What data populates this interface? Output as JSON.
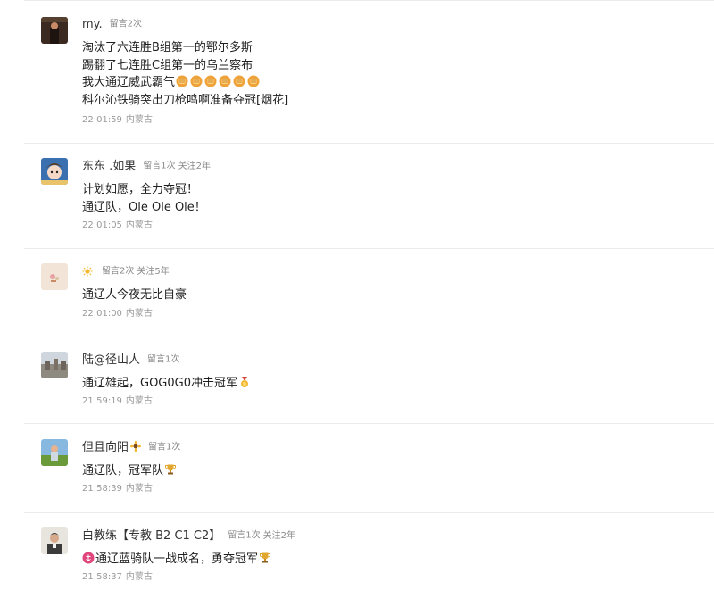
{
  "comments": [
    {
      "nickname": "my.",
      "stats": [
        "留言2次"
      ],
      "lines": [
        "淘汰了六连胜B组第一的鄂尔多斯",
        "踢翻了七连胜C组第一的乌兰察布",
        "我大通辽威武霸气",
        "科尔沁铁骑突出刀枪鸣啊准备夺冠[烟花]"
      ],
      "time": "22:01:59",
      "location": "内蒙古",
      "colors": {
        "avatar": "#3b2a22"
      }
    },
    {
      "nickname": "东东 .如果",
      "stats": [
        "留言1次",
        "关注2年"
      ],
      "lines": [
        "计划如愿，全力夺冠！",
        "通辽队，Ole Ole Ole！"
      ],
      "time": "22:01:05",
      "location": "内蒙古",
      "colors": {
        "avatar": "#3a6fb0"
      }
    },
    {
      "nickname": "",
      "stats": [
        "留言2次",
        "关注5年"
      ],
      "lines": [
        "通辽人今夜无比自豪"
      ],
      "time": "22:01:00",
      "location": "内蒙古",
      "colors": {
        "avatar": "#f3e4d8"
      }
    },
    {
      "nickname": "陆@径山人",
      "stats": [
        "留言1次"
      ],
      "lines": [
        "通辽雄起，GOG0G0冲击冠军"
      ],
      "time": "21:59:19",
      "location": "内蒙古",
      "colors": {
        "avatar": "#b8c0c8"
      }
    },
    {
      "nickname": "但且向阳",
      "stats": [
        "留言1次"
      ],
      "lines": [
        "通辽队，冠军队"
      ],
      "time": "21:58:39",
      "location": "内蒙古",
      "colors": {
        "avatar": "#7aa94e"
      }
    },
    {
      "nickname": "白教练【专教 B2 C1 C2】",
      "stats": [
        "留言1次",
        "关注2年"
      ],
      "lines": [
        "通辽蓝骑队一战成名，勇夺冠军"
      ],
      "time": "21:58:37",
      "location": "内蒙古",
      "colors": {
        "avatar": "#d8d4cf"
      }
    }
  ],
  "icons": {
    "fist": "fist-emoji-icon",
    "sun": "sun-emoji-icon",
    "sunflower": "sunflower-emoji-icon",
    "medal": "gold-medal-emoji-icon",
    "trophy": "trophy-emoji-icon",
    "congrats": "congrats-badge-icon"
  },
  "colors": {
    "emoji_orange": "#f0a23a",
    "congrats_pink": "#e0457b",
    "divider": "#ececec",
    "muted_text": "#8a8a8a"
  }
}
